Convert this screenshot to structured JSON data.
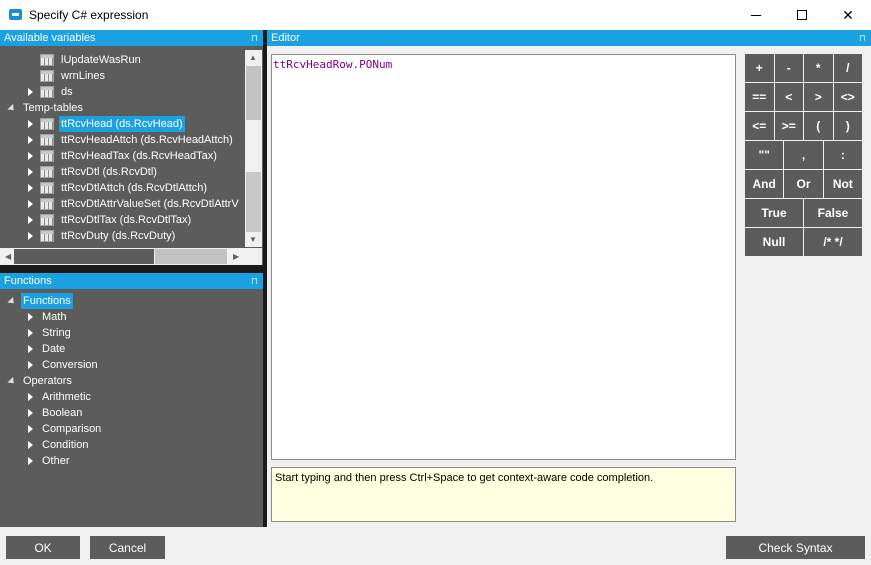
{
  "window": {
    "title": "Specify C# expression",
    "minimize_glyph": "",
    "close_glyph": "✕"
  },
  "variables_panel": {
    "header": "Available variables",
    "pin_glyph": "⊓",
    "items": [
      {
        "label": "lUpdateWasRun",
        "icon": "table-icon",
        "expander": "none",
        "indent": 1
      },
      {
        "label": "wrnLines",
        "icon": "table-icon",
        "expander": "none",
        "indent": 1
      },
      {
        "label": "ds",
        "icon": "table-icon",
        "expander": "closed",
        "indent": 1
      },
      {
        "label": "Temp-tables",
        "icon": "",
        "expander": "open",
        "indent": 0
      },
      {
        "label": "ttRcvHead (ds.RcvHead)",
        "icon": "table-icon",
        "expander": "closed",
        "indent": 1,
        "selected": true
      },
      {
        "label": "ttRcvHeadAttch (ds.RcvHeadAttch)",
        "icon": "table-icon",
        "expander": "closed",
        "indent": 1
      },
      {
        "label": "ttRcvHeadTax (ds.RcvHeadTax)",
        "icon": "table-icon",
        "expander": "closed",
        "indent": 1
      },
      {
        "label": "ttRcvDtl (ds.RcvDtl)",
        "icon": "table-icon",
        "expander": "closed",
        "indent": 1
      },
      {
        "label": "ttRcvDtlAttch (ds.RcvDtlAttch)",
        "icon": "table-icon",
        "expander": "closed",
        "indent": 1
      },
      {
        "label": "ttRcvDtlAttrValueSet (ds.RcvDtlAttrV",
        "icon": "table-icon",
        "expander": "closed",
        "indent": 1
      },
      {
        "label": "ttRcvDtlTax (ds.RcvDtlTax)",
        "icon": "table-icon",
        "expander": "closed",
        "indent": 1
      },
      {
        "label": "ttRcvDuty (ds.RcvDuty)",
        "icon": "table-icon",
        "expander": "closed",
        "indent": 1
      }
    ]
  },
  "functions_panel": {
    "header": "Functions",
    "pin_glyph": "⊓",
    "items": [
      {
        "label": "Functions",
        "expander": "open",
        "indent": 0,
        "selected": true
      },
      {
        "label": "Math",
        "expander": "closed",
        "indent": 1
      },
      {
        "label": "String",
        "expander": "closed",
        "indent": 1
      },
      {
        "label": "Date",
        "expander": "closed",
        "indent": 1
      },
      {
        "label": "Conversion",
        "expander": "closed",
        "indent": 1
      },
      {
        "label": "Operators",
        "expander": "open",
        "indent": 0
      },
      {
        "label": "Arithmetic",
        "expander": "closed",
        "indent": 1
      },
      {
        "label": "Boolean",
        "expander": "closed",
        "indent": 1
      },
      {
        "label": "Comparison",
        "expander": "closed",
        "indent": 1
      },
      {
        "label": "Condition",
        "expander": "closed",
        "indent": 1
      },
      {
        "label": "Other",
        "expander": "closed",
        "indent": 1
      }
    ]
  },
  "editor": {
    "header": "Editor",
    "pin_glyph": "⊓",
    "code": "ttRcvHeadRow.PONum",
    "hint": "Start typing and then press Ctrl+Space to get context-aware code completion."
  },
  "keypad": {
    "rows": [
      [
        "+",
        "-",
        "*",
        "/"
      ],
      [
        "==",
        "<",
        ">",
        "<>"
      ],
      [
        "<=",
        ">=",
        "(",
        ")"
      ],
      [
        "\"\"",
        ",",
        ":"
      ],
      [
        "And",
        "Or",
        "Not"
      ],
      [
        "True",
        "False"
      ],
      [
        "Null",
        "/* */"
      ]
    ]
  },
  "buttons": {
    "ok": "OK",
    "cancel": "Cancel",
    "check_syntax": "Check Syntax"
  },
  "colors": {
    "accent": "#1ba1e2",
    "panel_bg": "#5c5c5c",
    "code_color": "#800080",
    "hint_bg": "#ffffe1"
  }
}
